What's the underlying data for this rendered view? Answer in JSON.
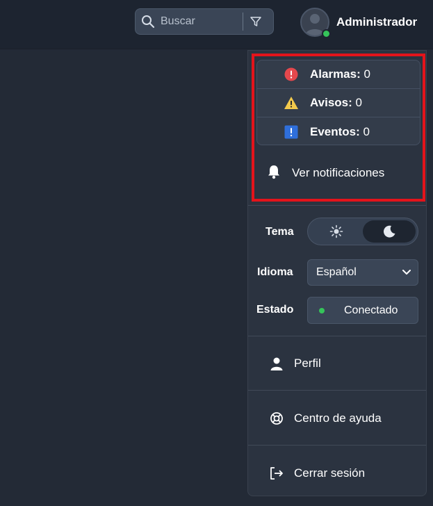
{
  "header": {
    "search": {
      "placeholder": "Buscar",
      "icon": "search-icon",
      "filter_icon": "filter-icon"
    },
    "user": {
      "name": "Administrador",
      "status_color": "#35c45a"
    }
  },
  "menu": {
    "counts": [
      {
        "label": "Alarmas:",
        "value": "0",
        "icon": "alarm-icon",
        "color": "#e5484d"
      },
      {
        "label": "Avisos:",
        "value": "0",
        "icon": "warning-icon",
        "color": "#f2c94c"
      },
      {
        "label": "Eventos:",
        "value": "0",
        "icon": "event-icon",
        "color": "#2f6fdb"
      }
    ],
    "see_notifications": "Ver notificaciones",
    "theme": {
      "label": "Tema",
      "selected": "dark"
    },
    "language": {
      "label": "Idioma",
      "value": "Español"
    },
    "status": {
      "label": "Estado",
      "value": "Conectado"
    },
    "items": [
      {
        "label": "Perfil",
        "icon": "user-icon"
      },
      {
        "label": "Centro de ayuda",
        "icon": "lifebuoy-icon"
      },
      {
        "label": "Cerrar sesión",
        "icon": "logout-icon"
      }
    ]
  }
}
